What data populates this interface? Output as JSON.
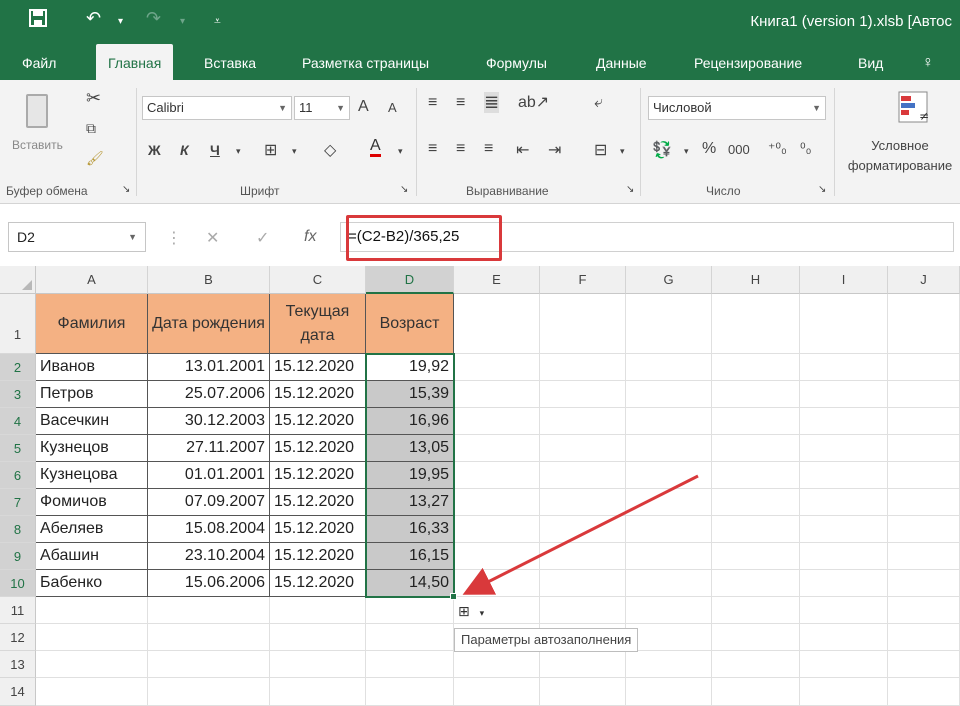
{
  "titlebar": {
    "title": "Книга1 (version 1).xlsb [Автос",
    "qat": {
      "save": "save-icon",
      "undo": "undo-icon",
      "redo": "redo-icon",
      "customize": "customize-icon"
    }
  },
  "tabs": [
    "Файл",
    "Главная",
    "Вставка",
    "Разметка страницы",
    "Формулы",
    "Данные",
    "Рецензирование",
    "Вид"
  ],
  "ribbon": {
    "paste_label": "Вставить",
    "clipboard_label": "Буфер обмена",
    "font_label": "Шрифт",
    "alignment_label": "Выравнивание",
    "number_label": "Число",
    "font_name": "Calibri",
    "font_size": "11",
    "bold": "Ж",
    "italic": "К",
    "underline": "Ч",
    "number_format": "Числовой",
    "percent": "%",
    "thousands": "000",
    "cond_format": "Условное форматирование",
    "grow_font": "A",
    "shrink_font": "A"
  },
  "formula_bar": {
    "name_box": "D2",
    "formula": "=(C2-B2)/365,25",
    "fx": "fx"
  },
  "sheet": {
    "columns": [
      "A",
      "B",
      "C",
      "D",
      "E",
      "F",
      "G",
      "H",
      "I",
      "J"
    ],
    "rows": [
      "1",
      "2",
      "3",
      "4",
      "5",
      "6",
      "7",
      "8",
      "9",
      "10",
      "11",
      "12",
      "13",
      "14"
    ],
    "headers": [
      "Фамилия",
      "Дата рождения",
      "Текущая дата",
      "Возраст"
    ],
    "data": [
      [
        "Иванов",
        "13.01.2001",
        "15.12.2020",
        "19,92"
      ],
      [
        "Петров",
        "25.07.2006",
        "15.12.2020",
        "15,39"
      ],
      [
        "Васечкин",
        "30.12.2003",
        "15.12.2020",
        "16,96"
      ],
      [
        "Кузнецов",
        "27.11.2007",
        "15.12.2020",
        "13,05"
      ],
      [
        "Кузнецова",
        "01.01.2001",
        "15.12.2020",
        "19,95"
      ],
      [
        "Фомичов",
        "07.09.2007",
        "15.12.2020",
        "13,27"
      ],
      [
        "Абеляев",
        "15.08.2004",
        "15.12.2020",
        "16,33"
      ],
      [
        "Абашин",
        "23.10.2004",
        "15.12.2020",
        "16,15"
      ],
      [
        "Бабенко",
        "15.06.2006",
        "15.12.2020",
        "14,50"
      ]
    ]
  },
  "autofill": {
    "tooltip": "Параметры автозаполнения"
  },
  "colors": {
    "excel_green": "#217346",
    "header_fill": "#f4b183",
    "highlight_red": "#d9393b"
  }
}
